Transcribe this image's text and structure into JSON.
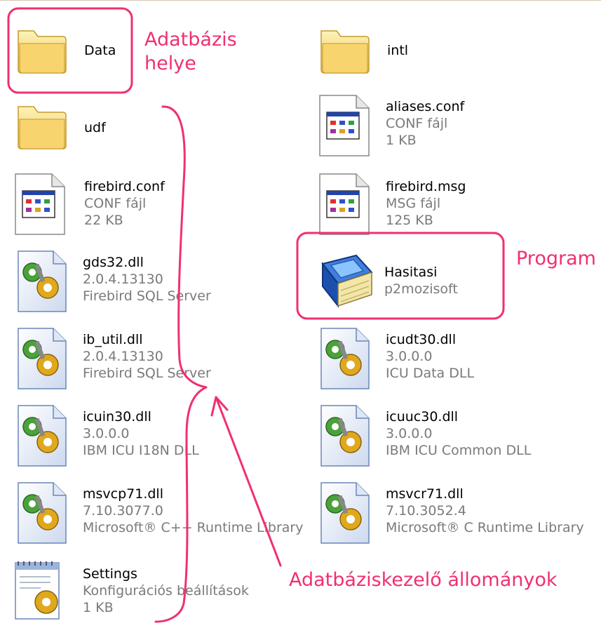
{
  "files": [
    {
      "name": "Data",
      "line1": "",
      "line2": "",
      "icon": "folder-icon"
    },
    {
      "name": "intl",
      "line1": "",
      "line2": "",
      "icon": "folder-icon"
    },
    {
      "name": "udf",
      "line1": "",
      "line2": "",
      "icon": "folder-icon"
    },
    {
      "name": "aliases.conf",
      "line1": "CONF fájl",
      "line2": "1 KB",
      "icon": "config-file-icon"
    },
    {
      "name": "firebird.conf",
      "line1": "CONF fájl",
      "line2": "22 KB",
      "icon": "config-file-icon"
    },
    {
      "name": "firebird.msg",
      "line1": "MSG fájl",
      "line2": "125 KB",
      "icon": "config-file-icon"
    },
    {
      "name": "gds32.dll",
      "line1": "2.0.4.13130",
      "line2": "Firebird SQL Server",
      "icon": "dll-file-icon"
    },
    {
      "name": "Hasitasi",
      "line1": "p2mozisoft",
      "line2": "",
      "icon": "book-app-icon"
    },
    {
      "name": "ib_util.dll",
      "line1": "2.0.4.13130",
      "line2": "Firebird SQL Server",
      "icon": "dll-file-icon"
    },
    {
      "name": "icudt30.dll",
      "line1": "3.0.0.0",
      "line2": "ICU Data DLL",
      "icon": "dll-file-icon"
    },
    {
      "name": "icuin30.dll",
      "line1": "3.0.0.0",
      "line2": "IBM ICU I18N DLL",
      "icon": "dll-file-icon"
    },
    {
      "name": "icuuc30.dll",
      "line1": "3.0.0.0",
      "line2": "IBM ICU Common DLL",
      "icon": "dll-file-icon"
    },
    {
      "name": "msvcp71.dll",
      "line1": "7.10.3077.0",
      "line2": "Microsoft® C++ Runtime Library",
      "icon": "dll-file-icon"
    },
    {
      "name": "msvcr71.dll",
      "line1": "7.10.3052.4",
      "line2": "Microsoft® C Runtime Library",
      "icon": "dll-file-icon"
    },
    {
      "name": "Settings",
      "line1": "Konfigurációs beállítások",
      "line2": "1 KB",
      "icon": "settings-file-icon"
    }
  ],
  "annotations": {
    "db_location_line1": "Adatbázis",
    "db_location_line2": "helye",
    "program": "Program",
    "db_files": "Adatbáziskezelő állományok",
    "color": "#f0306e"
  }
}
